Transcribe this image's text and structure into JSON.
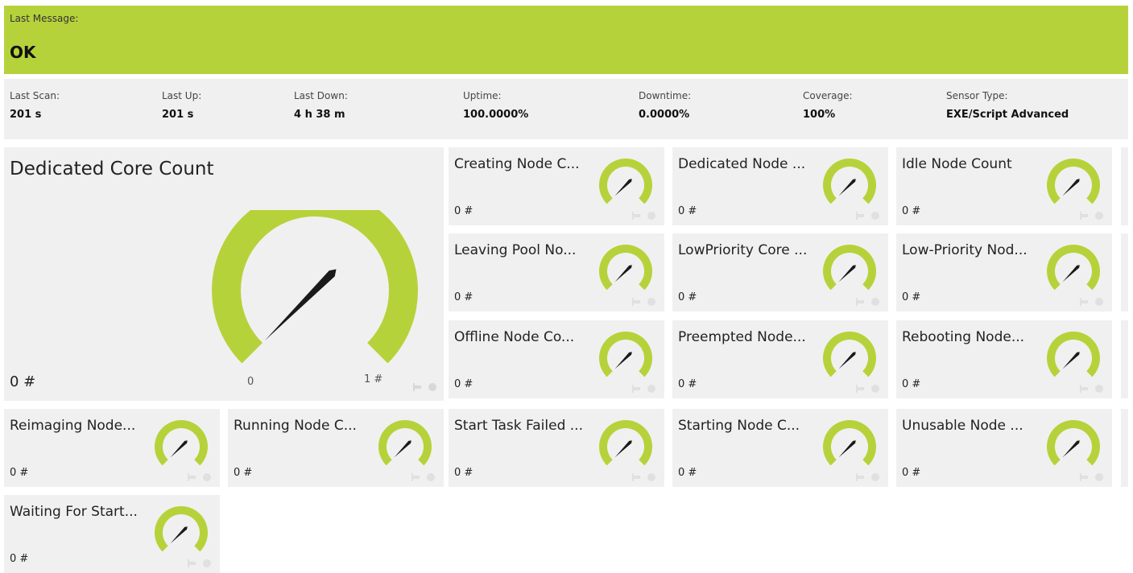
{
  "last_message": {
    "label": "Last Message:",
    "value": "OK"
  },
  "stats": [
    {
      "label": "Last Scan:",
      "value": "201 s"
    },
    {
      "label": "Last Up:",
      "value": "201 s"
    },
    {
      "label": "Last Down:",
      "value": "4 h 38 m"
    },
    {
      "label": "Uptime:",
      "value": "100.0000%"
    },
    {
      "label": "Downtime:",
      "value": "0.0000%"
    },
    {
      "label": "Coverage:",
      "value": "100%"
    },
    {
      "label": "Sensor Type:",
      "value": "EXE/Script Advanced"
    }
  ],
  "primary": {
    "title": "Dedicated Core Count",
    "value": "0 #",
    "gauge_min": "0",
    "gauge_max": "1 #",
    "gauge_level": 0
  },
  "channels": [
    {
      "title": "Creating Node C...",
      "value": "0 #",
      "gauge_level": 0
    },
    {
      "title": "Dedicated Node ...",
      "value": "0 #",
      "gauge_level": 0
    },
    {
      "title": "Idle Node Count",
      "value": "0 #",
      "gauge_level": 0
    },
    {
      "title": "Leaving Pool No...",
      "value": "0 #",
      "gauge_level": 0
    },
    {
      "title": "LowPriority Core ...",
      "value": "0 #",
      "gauge_level": 0
    },
    {
      "title": "Low-Priority Nod...",
      "value": "0 #",
      "gauge_level": 0
    },
    {
      "title": "Offline Node Co...",
      "value": "0 #",
      "gauge_level": 0
    },
    {
      "title": "Preempted Node...",
      "value": "0 #",
      "gauge_level": 0
    },
    {
      "title": "Rebooting Node...",
      "value": "0 #",
      "gauge_level": 0
    },
    {
      "title": "Reimaging Node...",
      "value": "0 #",
      "gauge_level": 0
    },
    {
      "title": "Running Node C...",
      "value": "0 #",
      "gauge_level": 0
    },
    {
      "title": "Start Task Failed ...",
      "value": "0 #",
      "gauge_level": 0
    },
    {
      "title": "Starting Node C...",
      "value": "0 #",
      "gauge_level": 0
    },
    {
      "title": "Unusable Node ...",
      "value": "0 #",
      "gauge_level": 0
    },
    {
      "title": "Waiting For Start...",
      "value": "0 #",
      "gauge_level": 0
    }
  ],
  "colors": {
    "accent": "#b6d23b",
    "panel": "#f1f0f0",
    "needle": "#1a1a1a"
  },
  "icons": {
    "pin": "pin-icon",
    "gear": "gear-icon"
  }
}
